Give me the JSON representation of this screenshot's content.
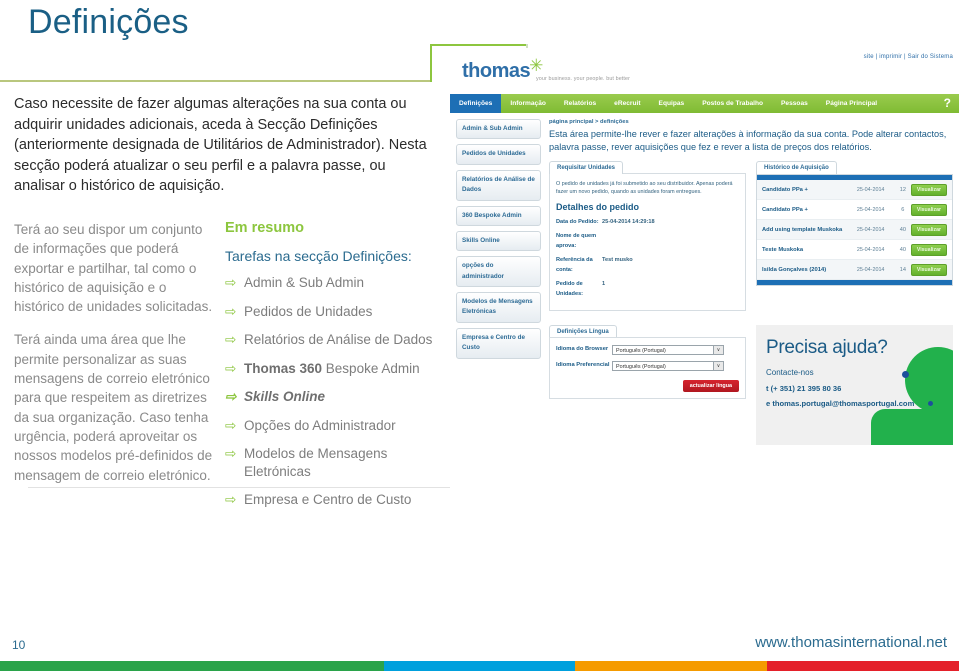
{
  "slide": {
    "title": "Definições",
    "page_number": "10",
    "website": "www.thomasinternational.net",
    "intro": "Caso necessite de fazer algumas alterações na sua conta ou adquirir unidades adicionais, aceda à Secção Definições (anteriormente designada de Utilitários de Administrador). Nesta secção poderá atualizar o seu perfil e a palavra passe, ou analisar o histórico de aquisição.",
    "left_paragraphs": [
      "Terá ao seu dispor um conjunto de informações que poderá exportar e partilhar, tal como o histórico de aquisição e o histórico de unidades solicitadas.",
      "Terá ainda uma área que lhe permite personalizar as suas mensagens de correio eletrónico para que respeitem as diretrizes da sua organização. Caso tenha urgência, poderá aproveitar os nossos modelos pré-definidos de mensagem de correio eletrónico."
    ],
    "footer_colors": [
      "#2aa34a",
      "#00a0dd",
      "#f59b00",
      "#e4202a"
    ]
  },
  "summary": {
    "heading": "Em resumo",
    "subheading": "Tarefas na secção Definições:",
    "arrow": "⇨",
    "items": [
      {
        "lead": "",
        "text": "Admin & Sub Admin",
        "style": "normal"
      },
      {
        "lead": "",
        "text": "Pedidos de Unidades",
        "style": "normal"
      },
      {
        "lead": "",
        "text": "Relatórios de Análise de Dados",
        "style": "normal"
      },
      {
        "lead": "Thomas 360",
        "text": " Bespoke Admin",
        "style": "bold-lead"
      },
      {
        "lead": "",
        "text": "Skills Online",
        "style": "italic-bold"
      },
      {
        "lead": "",
        "text": "Opções do Administrador",
        "style": "normal"
      },
      {
        "lead": "",
        "text": "Modelos de Mensagens Eletrónicas",
        "style": "normal"
      },
      {
        "lead": "",
        "text": "Empresa e Centro de Custo",
        "style": "normal"
      }
    ]
  },
  "screenshot": {
    "logo_word": "thomas",
    "logo_tagline": "your business. your people. but better",
    "top_links": "site | imprimir | Sair do Sistema",
    "help_glyph": "?",
    "nav": [
      {
        "label": "Página Principal",
        "active": false
      },
      {
        "label": "Pessoas",
        "active": false
      },
      {
        "label": "Postos de Trabalho",
        "active": false
      },
      {
        "label": "Equipas",
        "active": false
      },
      {
        "label": "eRecruit",
        "active": false
      },
      {
        "label": "Relatórios",
        "active": false
      },
      {
        "label": "Informação",
        "active": false
      },
      {
        "label": "Definições",
        "active": true
      }
    ],
    "sidebar": [
      "Admin & Sub Admin",
      "Pedidos de Unidades",
      "Relatórios de Análise de Dados",
      "360 Bespoke Admin",
      "Skills Online",
      "opções do administrador",
      "Modelos de Mensagens Eletrónicas",
      "Empresa e Centro de Custo"
    ],
    "breadcrumb": "página principal  >  definições",
    "lead_text": "Esta área permite-lhe rever e fazer alterações à informação da sua conta. Pode alterar contactos, palavra passe, rever aquisições que fez e rever a lista de preços dos relatórios.",
    "order_panel": {
      "tab": "Requisitar Unidades",
      "note": "O pedido de unidades já foi submetido ao seu distribuidor. Apenas poderá fazer um novo pedido, quando as unidades foram entregues.",
      "title": "Detalhes do pedido",
      "fields": [
        {
          "label": "Data do Pedido:",
          "value": "25-04-2014 14:29:18"
        },
        {
          "label": "Nome de quem aprova:",
          "value": ""
        },
        {
          "label": "Referência da conta:",
          "value": "Test musko"
        },
        {
          "label": "Pedido de Unidades:",
          "value": "1"
        }
      ]
    },
    "history_panel": {
      "tab": "Histórico de Aquisição",
      "view_label": "Visualizar",
      "rows": [
        {
          "name": "Candidato PPa +",
          "date": "25-04-2014",
          "qty": "12"
        },
        {
          "name": "Candidato PPa +",
          "date": "25-04-2014",
          "qty": "6"
        },
        {
          "name": "Add using template Muskoka",
          "date": "25-04-2014",
          "qty": "40"
        },
        {
          "name": "Teste Muskoka",
          "date": "25-04-2014",
          "qty": "40"
        },
        {
          "name": "Isilda Gonçalves (2014)",
          "date": "25-04-2014",
          "qty": "14"
        }
      ]
    },
    "language_panel": {
      "tab": "Definições Língua",
      "rows": [
        {
          "label": "Idioma do Browser",
          "value": "Português (Portugal)"
        },
        {
          "label": "Idioma Preferencial",
          "value": "Português (Portugal)"
        }
      ],
      "button": "actualizar língua",
      "chevron": "∨"
    },
    "help_box": {
      "title": "Precisa ajuda?",
      "contact_label": "Contacte-nos",
      "phone": "t (+ 351) 21 395 80 36",
      "email": "e thomas.portugal@thomasportugal.com"
    }
  }
}
